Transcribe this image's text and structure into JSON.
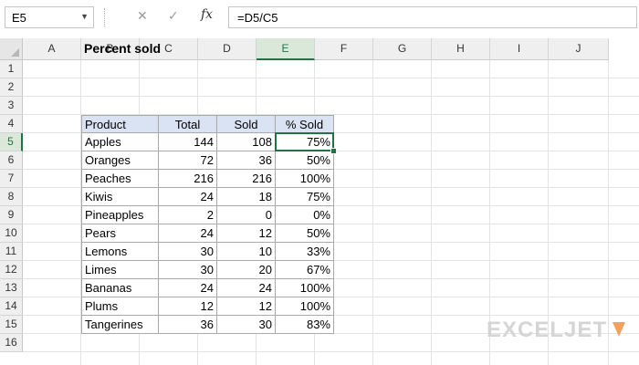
{
  "formula_bar": {
    "name_box": "E5",
    "cancel_icon": "✕",
    "enter_icon": "✓",
    "fx_label": "fx",
    "formula": "=D5/C5"
  },
  "columns": [
    "A",
    "B",
    "C",
    "D",
    "E",
    "F",
    "G",
    "H",
    "I",
    "J"
  ],
  "rows": [
    "1",
    "2",
    "3",
    "4",
    "5",
    "6",
    "7",
    "8",
    "9",
    "10",
    "11",
    "12",
    "13",
    "14",
    "15",
    "16"
  ],
  "selection": {
    "column": "E",
    "row": "5"
  },
  "title": "Percent sold",
  "table": {
    "headers": [
      "Product",
      "Total",
      "Sold",
      "% Sold"
    ],
    "rows": [
      [
        "Apples",
        "144",
        "108",
        "75%"
      ],
      [
        "Oranges",
        "72",
        "36",
        "50%"
      ],
      [
        "Peaches",
        "216",
        "216",
        "100%"
      ],
      [
        "Kiwis",
        "24",
        "18",
        "75%"
      ],
      [
        "Pineapples",
        "2",
        "0",
        "0%"
      ],
      [
        "Pears",
        "24",
        "12",
        "50%"
      ],
      [
        "Lemons",
        "30",
        "10",
        "33%"
      ],
      [
        "Limes",
        "30",
        "20",
        "67%"
      ],
      [
        "Bananas",
        "24",
        "24",
        "100%"
      ],
      [
        "Plums",
        "12",
        "12",
        "100%"
      ],
      [
        "Tangerines",
        "36",
        "30",
        "83%"
      ]
    ]
  },
  "logo": {
    "text": "EXCELJET",
    "color": "#d5d5d5"
  },
  "colors": {
    "accent": "#217346",
    "header_fill": "#dae3f3"
  }
}
